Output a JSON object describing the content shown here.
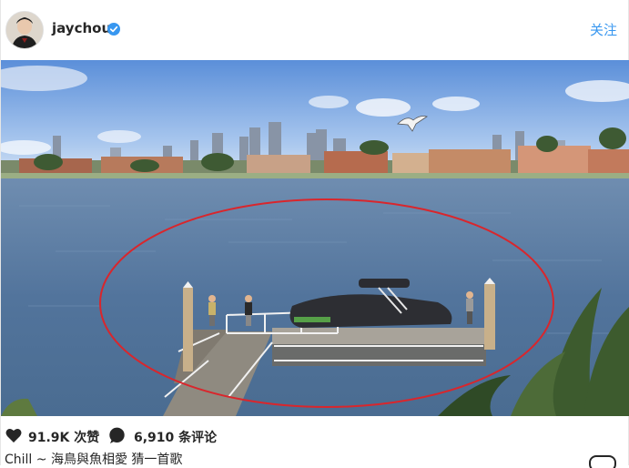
{
  "post": {
    "username": "jaychou",
    "follow_label": "关注",
    "likes_label": "91.9K 次赞",
    "comments_label": "6,910 条评论",
    "caption": "Chill ~ 海鳥與魚相愛 猜一首歌"
  },
  "icons": {
    "avatar": "profile-photo",
    "verified": "verified-badge-icon",
    "like": "heart-icon",
    "comment": "comment-bubble-icon",
    "more": "more-options-icon"
  },
  "colors": {
    "link": "#3897f0",
    "verified": "#3897f0",
    "annotation_ellipse": "#d9262c"
  }
}
